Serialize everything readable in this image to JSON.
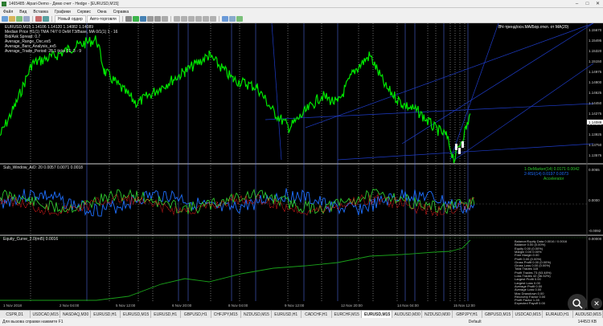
{
  "window": {
    "title": "1465485: Alpari-Demo - Демо счет - Hedge - [EURUSD,M15]"
  },
  "menu": [
    "Файл",
    "Вид",
    "Вставка",
    "Графики",
    "Сервис",
    "Окна",
    "Справка"
  ],
  "toolbar": {
    "new_order": "Новый ордер",
    "autotrading": "Авто-торговля"
  },
  "colors": {
    "price": "#00e600",
    "osc_blue": "#1e6fff",
    "osc_green": "#2ec82e",
    "osc_red": "#ff2020",
    "vlines": "#5a78ff",
    "equity": "#1aa01a",
    "trend": "#1e3cc8"
  },
  "panes": {
    "main": {
      "header": "EURUSD,M15 1.14106 1.14120 1.14082 1.14089",
      "lines": [
        "Median Price H1(1) TMA 74/7 0 DeM T3/Base, MA 0/1(1) 1 - 16",
        "Bid/Ask Spread: 0.7",
        "Average_Range_Osc.ex5",
        "Average_Bars_Analysis_ex5",
        "Average_Trade_Period: 28.1 ticks 31: 3 - 9"
      ],
      "right_labels": [
        "1.15670",
        "1.15495",
        "1.15320",
        "1.15150",
        "1.14975",
        "1.14800",
        "1.14625",
        "1.14450",
        "1.14275",
        "1.14100",
        "1.13925",
        "1.13750",
        "1.13575"
      ],
      "current_price": "1.14089",
      "note": "ВЧ-тренд/осн.МА/Бор.откл. от MA(20)"
    },
    "osc": {
      "header": "Sub_Window_AiO: 20 0.0057 0.0071 0.0018",
      "legend": [
        "1-DeMarker(14) 0.0171 0.0042",
        "2-RSI(14) 0.0197 0.0073",
        "Accelerator"
      ],
      "right_labels": [
        "0.0065",
        "0.0000",
        "-0.0092"
      ]
    },
    "equity": {
      "header": "Equity_Curve_2.0(mt5) 0.0016",
      "right_labels": [
        "0.00000"
      ],
      "stats": [
        "Balance/Equity Data  0.0016 / 0.0016",
        "Balance  0.00 (0.00%)",
        "Equity  0.00 (0.00%)",
        "Margin  0.00 0.00%",
        "Free Margin  0.00",
        "Profit  0.00 (0.00%)",
        "Gross Profit  0.00 (0.00%)",
        "Gross Loss  0.00 (0.00%)",
        "Total Trades  115",
        "Profit Trades  73 (63.48%)",
        "Loss Trades  42 (36.52%)",
        "Largest Profit  0.00",
        "Largest Loss  0.00",
        "Average Profit  0.00",
        "Average Loss  0.00",
        "Max Drawdown  0.00",
        "Recovery Factor  0.00",
        "Profit Factor  1.28",
        "Expected Payoff  0.00"
      ]
    }
  },
  "tabs": [
    "CSPR,D1",
    "USDCAD,M15",
    "NASDAQ,M30",
    "EURUSD,H1",
    "EURUSD,M15",
    "EURUSD,H1",
    "GBPUSD,H1",
    "CHFJPY,M15",
    "NZDUSD,M15",
    "EURUSD,H1",
    "CADCHF,H1",
    "EURCHF,M15",
    "EURUSD,M15",
    "AUDUSD,M30",
    "NZDUSD,M30",
    "GBPJPY,H1",
    "GBPUSD,M15",
    "USDCAD,M15",
    "EURAUD,H1",
    "AUDUSD,M15"
  ],
  "active_tab": "EURUSD,M15",
  "bottom_axis": [
    "1 Nov 2018",
    "2 Nov 04:00",
    "5 Nov 12:00",
    "6 Nov 20:00",
    "8 Nov 04:00",
    "9 Nov 12:00",
    "12 Nov 20:00",
    "14 Nov 04:00",
    "15 Nov 12:00"
  ],
  "status": {
    "help": "Для вызова справки нажмите F1",
    "profile": "Default",
    "traffic": "1445/3 KB"
  }
}
